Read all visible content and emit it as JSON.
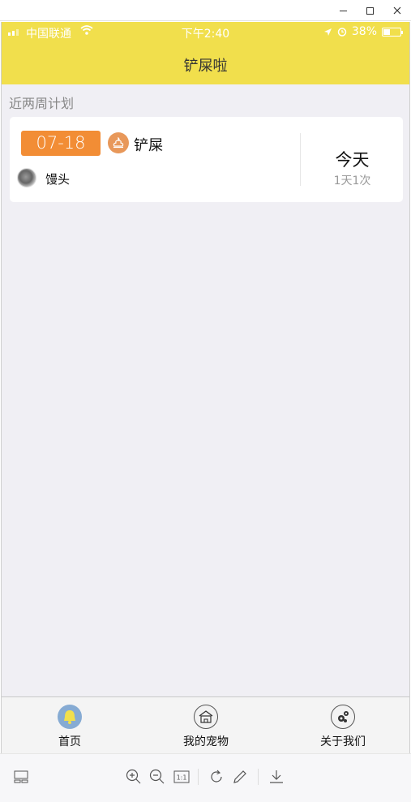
{
  "statusbar": {
    "carrier": "中国联通",
    "time": "下午2:40",
    "battery": "38%",
    "battery_level": 0.38
  },
  "nav": {
    "title": "铲屎啦"
  },
  "section": {
    "title": "近两周计划"
  },
  "plan": {
    "date": "07-18",
    "task_icon": "poop-icon",
    "task": "铲屎",
    "pet_name": "馒头",
    "when": "今天",
    "frequency": "1天1次"
  },
  "tabs": [
    {
      "label": "首页",
      "icon": "bell-icon"
    },
    {
      "label": "我的宠物",
      "icon": "pet-house-icon"
    },
    {
      "label": "关于我们",
      "icon": "gears-icon"
    }
  ],
  "colors": {
    "header": "#f1df4c",
    "date_badge": "#f28d35",
    "task_icon_bg": "#e8985a",
    "tab_home_icon_bg": "#86abd3",
    "page_bg": "#f0eff4"
  },
  "viewer_tools": [
    "layout-icon",
    "zoom-in-icon",
    "zoom-out-icon",
    "actual-size-icon",
    "rotate-icon",
    "edit-icon",
    "download-icon"
  ],
  "viewer": {
    "actual_size_label": "1:1"
  }
}
